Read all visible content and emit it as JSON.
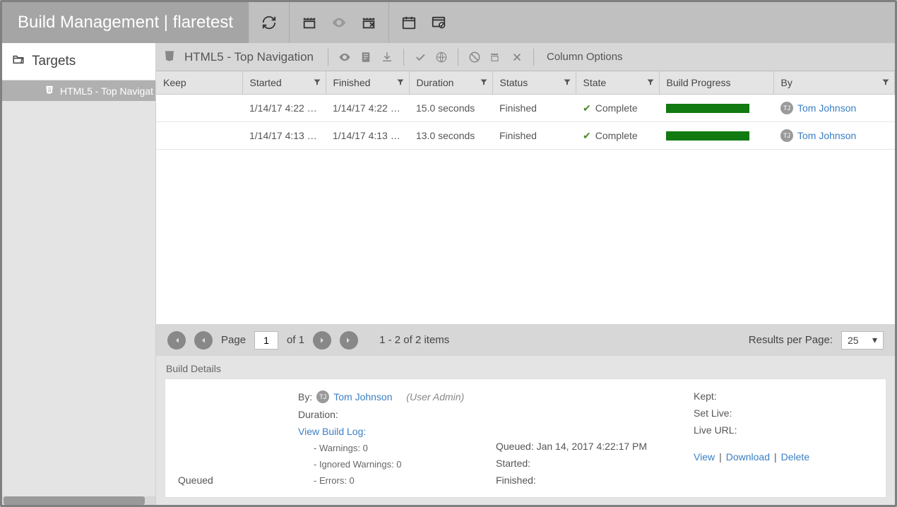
{
  "header": {
    "title": "Build Management  |  flaretest"
  },
  "sidebar": {
    "heading": "Targets",
    "items": [
      {
        "label": "HTML5 - Top Navigat"
      }
    ]
  },
  "sub_toolbar": {
    "title": "HTML5 - Top Navigation",
    "column_options": "Column Options"
  },
  "table": {
    "columns": {
      "keep": "Keep",
      "started": "Started",
      "finished": "Finished",
      "duration": "Duration",
      "status": "Status",
      "state": "State",
      "build_progress": "Build Progress",
      "by": "By"
    },
    "rows": [
      {
        "keep": "",
        "started": "1/14/17 4:22 P…",
        "finished": "1/14/17 4:22 P…",
        "duration": "15.0 seconds",
        "status": "Finished",
        "state": "Complete",
        "by_initials": "TJ",
        "by_name": "Tom Johnson"
      },
      {
        "keep": "",
        "started": "1/14/17 4:13 P…",
        "finished": "1/14/17 4:13 P…",
        "duration": "13.0 seconds",
        "status": "Finished",
        "state": "Complete",
        "by_initials": "TJ",
        "by_name": "Tom Johnson"
      }
    ]
  },
  "pagination": {
    "page_label": "Page",
    "page_value": "1",
    "of_label": "of 1",
    "range_label": "1 - 2 of 2 items",
    "rpp_label": "Results per Page:",
    "rpp_value": "25"
  },
  "details": {
    "section_label": "Build Details",
    "status_text": "Queued",
    "by_label": "By:",
    "by_initials": "TJ",
    "by_name": "Tom Johnson",
    "by_role": "(User Admin)",
    "duration_label": "Duration:",
    "view_log": "View Build Log:",
    "warnings": "- Warnings: 0",
    "ignored_warnings": "- Ignored Warnings: 0",
    "errors": "- Errors: 0",
    "queued_label": "Queued: Jan 14, 2017 4:22:17 PM",
    "started_label": "Started:",
    "finished_label": "Finished:",
    "kept_label": "Kept:",
    "set_live_label": "Set Live:",
    "live_url_label": "Live URL:",
    "view": "View",
    "download": "Download",
    "delete": "Delete",
    "sep": " | "
  }
}
